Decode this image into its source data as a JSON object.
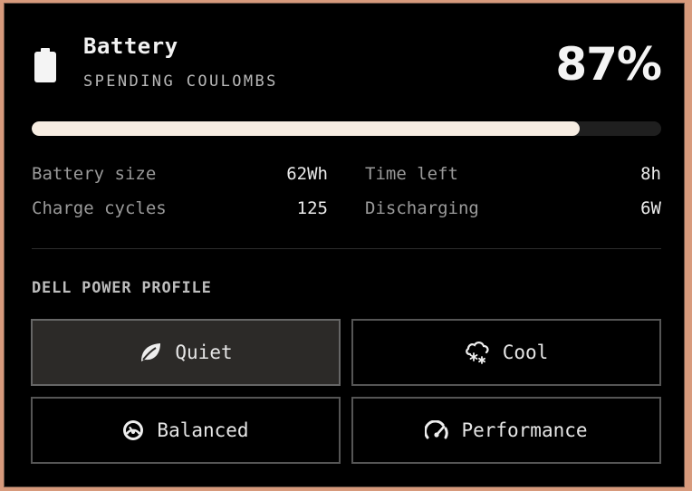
{
  "header": {
    "title": "Battery",
    "subtitle": "SPENDING COULOMBS",
    "percent_text": "87%",
    "icon": "battery-icon"
  },
  "progress": {
    "fraction": 0.87
  },
  "stats": {
    "battery_size": {
      "label": "Battery size",
      "value": "62Wh"
    },
    "charge_cycles": {
      "label": "Charge cycles",
      "value": "125"
    },
    "time_left": {
      "label": "Time left",
      "value": "8h"
    },
    "discharging": {
      "label": "Discharging",
      "value": "6W"
    }
  },
  "profile": {
    "section_label": "DELL POWER PROFILE",
    "options": [
      {
        "label": "Quiet",
        "icon": "leaf-icon",
        "selected": true
      },
      {
        "label": "Cool",
        "icon": "snow-cloud-icon",
        "selected": false
      },
      {
        "label": "Balanced",
        "icon": "gauge-icon",
        "selected": false
      },
      {
        "label": "Performance",
        "icon": "speedometer-icon",
        "selected": false
      }
    ]
  },
  "colors": {
    "background": "#000000",
    "progress_fill": "#f7ede2",
    "progress_track": "#1f1f1f",
    "selected_button": "#2c2a28",
    "frame": "#d79a7c"
  }
}
